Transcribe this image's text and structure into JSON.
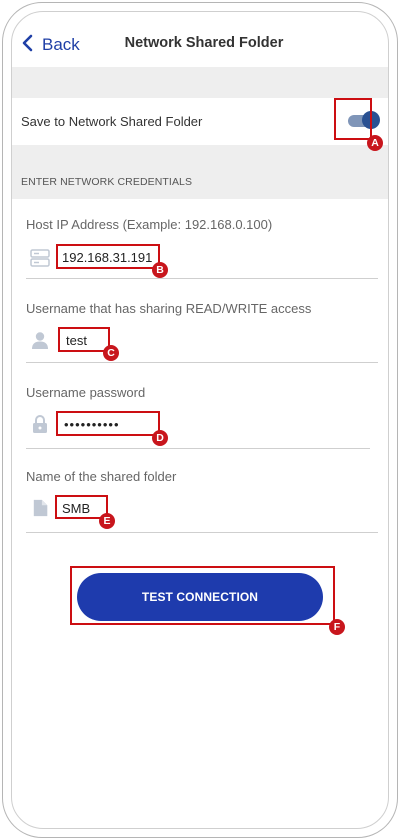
{
  "header": {
    "back_label": "Back",
    "title": "Network Shared Folder"
  },
  "save_toggle": {
    "label": "Save to Network Shared Folder",
    "enabled": true,
    "marker": "A"
  },
  "section": {
    "label": "ENTER NETWORK CREDENTIALS"
  },
  "fields": [
    {
      "label": "Host IP Address (Example: 192.168.0.100)",
      "value": "192.168.31.191",
      "icon": "server-icon",
      "marker": "B"
    },
    {
      "label": "Username that has sharing READ/WRITE access",
      "value": "test",
      "icon": "user-icon",
      "marker": "C"
    },
    {
      "label": "Username password",
      "value": "••••••••••",
      "icon": "lock-icon",
      "marker": "D"
    },
    {
      "label": "Name of the shared folder",
      "value": "SMB",
      "icon": "document-icon",
      "marker": "E"
    }
  ],
  "test_button": {
    "label": "TEST CONNECTION",
    "marker": "F"
  },
  "colors": {
    "accent": "#1e3bad",
    "annotation": "#cc0e12",
    "toggle_on": "#2a5192"
  }
}
